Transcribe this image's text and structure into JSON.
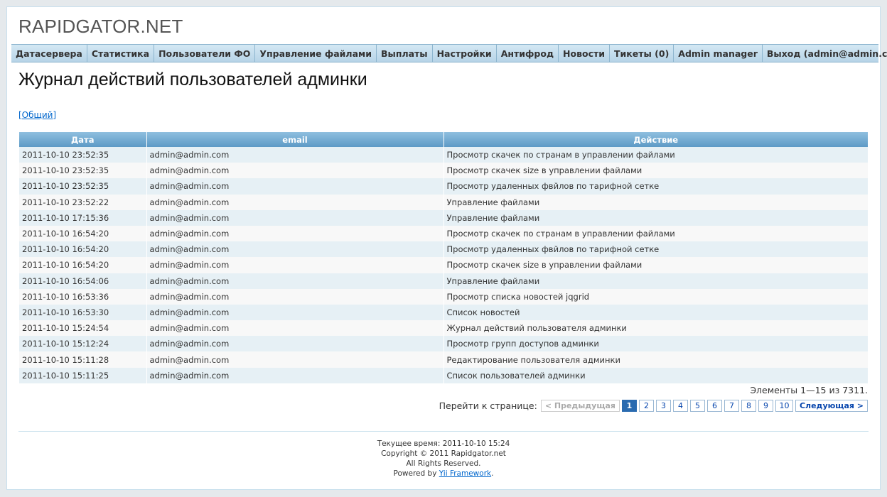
{
  "site": {
    "logo": "RAPIDGATOR.NET"
  },
  "menu": [
    {
      "label": "Датасервера"
    },
    {
      "label": "Статистика"
    },
    {
      "label": "Пользователи ФО"
    },
    {
      "label": "Управление файлами"
    },
    {
      "label": "Выплаты"
    },
    {
      "label": "Настройки"
    },
    {
      "label": "Антифрод"
    },
    {
      "label": "Новости"
    },
    {
      "label": "Тикеты (0)"
    },
    {
      "label": "Admin manager"
    },
    {
      "label": "Выход (admin@admin.com)"
    }
  ],
  "page": {
    "title": "Журнал действий пользователей админки",
    "filter_link": "[Общий]"
  },
  "table": {
    "columns": [
      "Дата",
      "email",
      "Действие"
    ],
    "rows": [
      [
        "2011-10-10 23:52:35",
        "admin@admin.com",
        "Просмотр скачек по странам в управлении файлами"
      ],
      [
        "2011-10-10 23:52:35",
        "admin@admin.com",
        "Просмотр скачек size в управлении файлами"
      ],
      [
        "2011-10-10 23:52:35",
        "admin@admin.com",
        "Просмотр удаленных фвйлов по тарифной сетке"
      ],
      [
        "2011-10-10 23:52:22",
        "admin@admin.com",
        "Управление файлами"
      ],
      [
        "2011-10-10 17:15:36",
        "admin@admin.com",
        "Управление файлами"
      ],
      [
        "2011-10-10 16:54:20",
        "admin@admin.com",
        "Просмотр скачек по странам в управлении файлами"
      ],
      [
        "2011-10-10 16:54:20",
        "admin@admin.com",
        "Просмотр удаленных фвйлов по тарифной сетке"
      ],
      [
        "2011-10-10 16:54:20",
        "admin@admin.com",
        "Просмотр скачек size в управлении файлами"
      ],
      [
        "2011-10-10 16:54:06",
        "admin@admin.com",
        "Управление файлами"
      ],
      [
        "2011-10-10 16:53:36",
        "admin@admin.com",
        "Просмотр списка новостей jqgrid"
      ],
      [
        "2011-10-10 16:53:30",
        "admin@admin.com",
        "Список новостей"
      ],
      [
        "2011-10-10 15:24:54",
        "admin@admin.com",
        "Журнал действий пользователя админки"
      ],
      [
        "2011-10-10 15:12:24",
        "admin@admin.com",
        "Просмотр групп доступов админки"
      ],
      [
        "2011-10-10 15:11:28",
        "admin@admin.com",
        "Редактирование пользователя админки"
      ],
      [
        "2011-10-10 15:11:25",
        "admin@admin.com",
        "Список пользователей админки"
      ]
    ]
  },
  "summary": "Элементы 1—15 из 7311.",
  "pager": {
    "label": "Перейти к странице:",
    "prev": "< Предыдущая",
    "pages": [
      "1",
      "2",
      "3",
      "4",
      "5",
      "6",
      "7",
      "8",
      "9",
      "10"
    ],
    "current": "1",
    "next": "Следующая >"
  },
  "footer": {
    "time": "Текущее время: 2011-10-10 15:24",
    "copyright": "Copyright © 2011 Rapidgator.net",
    "rights": "All Rights Reserved.",
    "powered_prefix": "Powered by ",
    "powered_link": "Yii Framework",
    "powered_suffix": "."
  },
  "colors": {
    "header_gradient_top": "#8fbfdf",
    "header_gradient_bottom": "#5d9ac6",
    "row_odd": "#e6f0f5",
    "row_even": "#f8f8f8",
    "link": "#0066cc",
    "pager_selected": "#2a6bb0"
  }
}
